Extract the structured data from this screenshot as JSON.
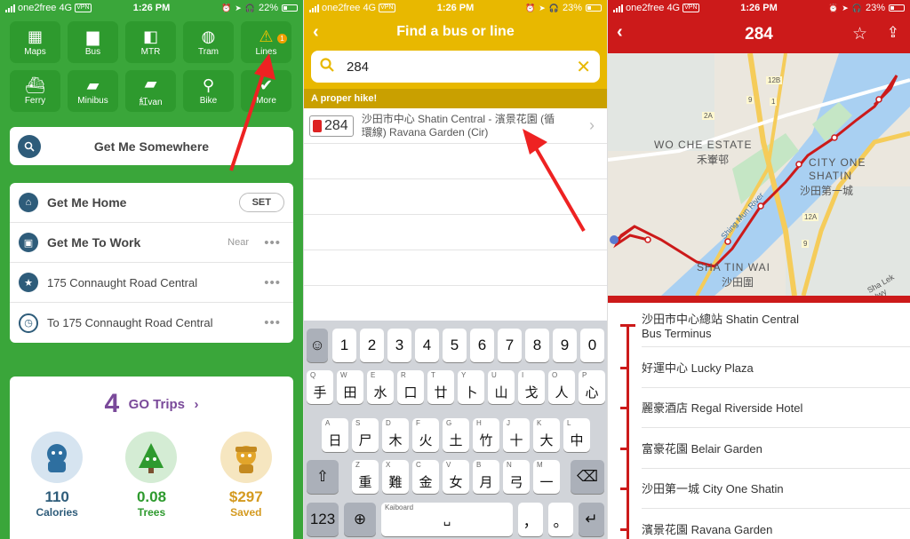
{
  "status_bars": [
    {
      "carrier": "one2free",
      "network": "4G",
      "vpn": "VPN",
      "time": "1:26 PM",
      "battery": "22%",
      "battery_level": 0.22
    },
    {
      "carrier": "one2free",
      "network": "4G",
      "vpn": "VPN",
      "time": "1:26 PM",
      "battery": "23%",
      "battery_level": 0.23
    },
    {
      "carrier": "one2free",
      "network": "4G",
      "vpn": "VPN",
      "time": "1:26 PM",
      "battery": "23%",
      "battery_level": 0.23
    }
  ],
  "home": {
    "tiles": [
      {
        "label": "Maps",
        "icon": "map-icon"
      },
      {
        "label": "Bus",
        "icon": "bus-icon"
      },
      {
        "label": "MTR",
        "icon": "train-icon"
      },
      {
        "label": "Tram",
        "icon": "tram-icon"
      },
      {
        "label": "Lines",
        "icon": "warning-icon",
        "badge": "1"
      },
      {
        "label": "Ferry",
        "icon": "ferry-icon"
      },
      {
        "label": "Minibus",
        "icon": "minibus-icon"
      },
      {
        "label": "紅van",
        "icon": "red-minibus-icon"
      },
      {
        "label": "Bike",
        "icon": "bike-icon"
      },
      {
        "label": "More",
        "icon": "checkmark-icon"
      }
    ],
    "get_me_somewhere": "Get Me Somewhere",
    "saved": {
      "home_label": "Get Me Home",
      "set_label": "SET",
      "work_label": "Get Me To Work",
      "near_label": "Near",
      "fav_label": "175 Connaught Road Central",
      "recent_label": "To 175 Connaught Road Central"
    },
    "trips": {
      "count": "4",
      "label": "GO Trips",
      "chevron": "›",
      "calories_value": "110",
      "calories_label": "Calories",
      "trees_value": "0.08",
      "trees_label": "Trees",
      "saved_value": "$297",
      "saved_label": "Saved"
    }
  },
  "search": {
    "title": "Find a bus or line",
    "query": "284",
    "section": "A proper hike!",
    "result_route": "284",
    "result_desc_line1": "沙田市中心 Shatin Central - 濱景花園 (循",
    "result_desc_line2": "環線) Ravana Garden (Cir)",
    "keyboard": {
      "numbers": [
        "1",
        "2",
        "3",
        "4",
        "5",
        "6",
        "7",
        "8",
        "9",
        "0"
      ],
      "row1": [
        [
          "Q",
          "手"
        ],
        [
          "W",
          "田"
        ],
        [
          "E",
          "水"
        ],
        [
          "R",
          "口"
        ],
        [
          "T",
          "廿"
        ],
        [
          "Y",
          "卜"
        ],
        [
          "U",
          "山"
        ],
        [
          "I",
          "戈"
        ],
        [
          "O",
          "人"
        ],
        [
          "P",
          "心"
        ]
      ],
      "row2": [
        [
          "A",
          "日"
        ],
        [
          "S",
          "尸"
        ],
        [
          "D",
          "木"
        ],
        [
          "F",
          "火"
        ],
        [
          "G",
          "土"
        ],
        [
          "H",
          "竹"
        ],
        [
          "J",
          "十"
        ],
        [
          "K",
          "大"
        ],
        [
          "L",
          "中"
        ]
      ],
      "row3": [
        [
          "Z",
          "重"
        ],
        [
          "X",
          "難"
        ],
        [
          "C",
          "金"
        ],
        [
          "V",
          "女"
        ],
        [
          "B",
          "月"
        ],
        [
          "N",
          "弓"
        ],
        [
          "M",
          "一"
        ]
      ],
      "num_switch": "123",
      "space_label": "Kaiboard",
      "comma": "，",
      "period": "。"
    }
  },
  "route": {
    "title": "284",
    "map_labels": {
      "wo_che_en": "WO CHE ESTATE",
      "wo_che_zh": "禾輋邨",
      "city_one_en1": "CITY ONE",
      "city_one_en2": "SHATIN",
      "city_one_zh": "沙田第一城",
      "sha_tin_wai_en": "SHA TIN WAI",
      "sha_tin_wai_zh": "沙田圍",
      "river": "Shing Mun River",
      "road": "Sha Lek Hwy",
      "r1": "12B",
      "r2": "12A",
      "r3": "2A",
      "r4": "9",
      "r5": "1",
      "r6": "9"
    },
    "stops": [
      {
        "line1": "沙田市中心總站 Shatin Central",
        "line2": "Bus Terminus"
      },
      {
        "line1": "好運中心 Lucky Plaza"
      },
      {
        "line1": "麗豪酒店 Regal Riverside Hotel"
      },
      {
        "line1": "富豪花園 Belair Garden"
      },
      {
        "line1": "沙田第一城 City One Shatin"
      },
      {
        "line1": "濱景花園 Ravana Garden"
      }
    ]
  },
  "colors": {
    "green": "#3aa63a",
    "yellow": "#e8b800",
    "red": "#cc1a1a",
    "navy": "#2e5c7a",
    "purple": "#7a4a9a"
  }
}
